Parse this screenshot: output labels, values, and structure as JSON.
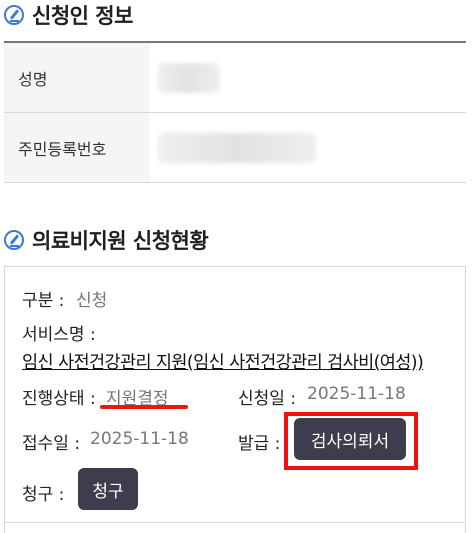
{
  "applicant_section": {
    "title": "신청인 정보",
    "rows": [
      {
        "label": "성명"
      },
      {
        "label": "주민등록번호"
      }
    ]
  },
  "medical_section": {
    "title": "의료비지원 신청현황",
    "category_label": "구분 :",
    "category_value": "신청",
    "service_label": "서비스명 :",
    "service_name": "임신 사전건강관리 지원(임신 사전건강관리 검사비(여성))",
    "status_label": "진행상태 :",
    "status_value": "지원결정",
    "apply_date_label": "신청일 :",
    "apply_date": "2025-11-18",
    "receipt_date_label": "접수일 :",
    "receipt_date": "2025-11-18",
    "issue_label": "발급 :",
    "issue_button": "검사의뢰서",
    "claim_label": "청구 :",
    "claim_button": "청구"
  },
  "colors": {
    "accent_icon": "#3a7bd5",
    "button_bg": "#3d3d4d",
    "highlight_red": "#e41a1a"
  }
}
